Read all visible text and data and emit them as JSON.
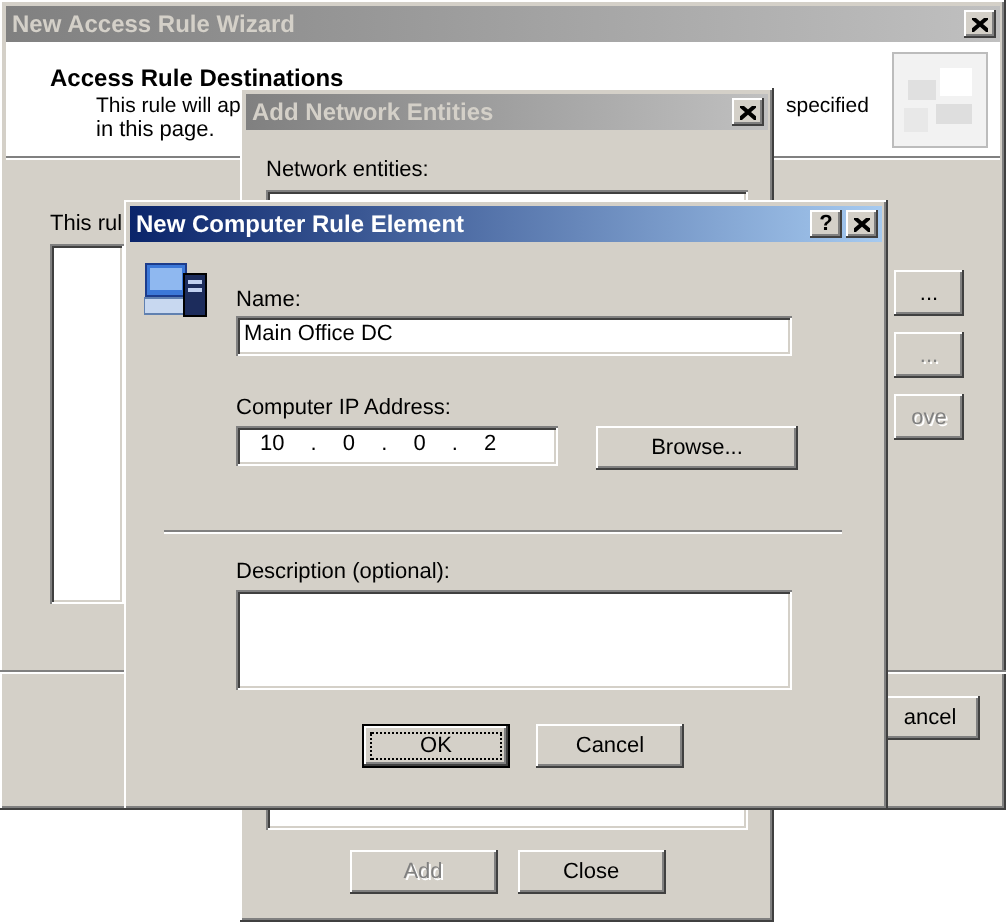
{
  "windows": [
    {
      "kind": "wizard",
      "title": "New Access Rule Wizard",
      "active": false,
      "header": {
        "heading": "Access Rule Destinations",
        "description": [
          "This rule will ap",
          "specified",
          "in this page."
        ]
      },
      "intro": "This rul",
      "side_buttons": [
        {
          "label": "...",
          "disabled": false
        },
        {
          "label": "...",
          "disabled": true
        },
        {
          "label": "ove",
          "disabled": true
        }
      ],
      "footer_buttons": [
        {
          "label": "ancel",
          "disabled": false
        }
      ]
    },
    {
      "kind": "entities",
      "title": "Add Network Entities",
      "active": false,
      "list_label": "Network entities:",
      "buttons": [
        {
          "label": "Add",
          "disabled": true
        },
        {
          "label": "Close",
          "disabled": false
        }
      ]
    },
    {
      "kind": "element",
      "title": "New Computer Rule Element",
      "active": true,
      "help_button": "?",
      "name_label": "Name:",
      "name_value": "Main Office DC",
      "ip_label": "Computer IP Address:",
      "ip_value": "10 . 0 . 0 . 2",
      "browse_button": "Browse...",
      "description_label": "Description (optional):",
      "buttons": [
        {
          "label": "OK",
          "default": true
        },
        {
          "label": "Cancel",
          "default": false
        }
      ]
    }
  ]
}
